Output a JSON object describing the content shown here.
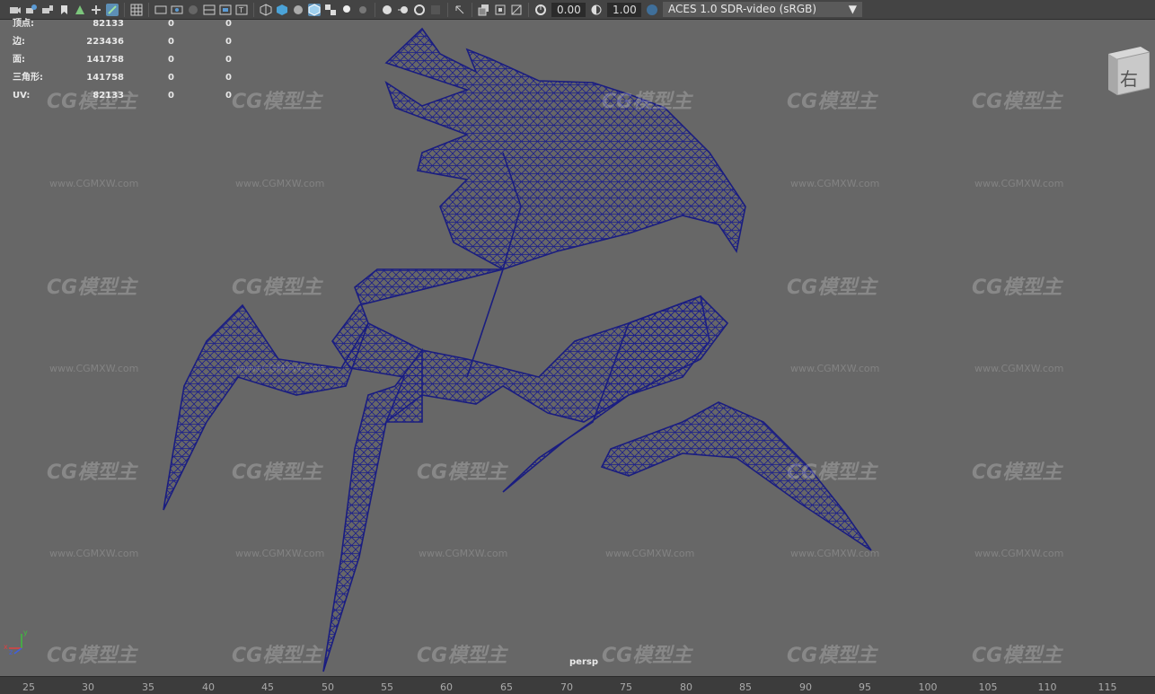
{
  "toolbar": {
    "icons": [
      "camera-icon",
      "camera-attr-icon",
      "bookmark-icon",
      "image-plane-icon",
      "2d-pan-icon",
      "grease-pencil-icon",
      "grid-icon",
      "film-gate-icon",
      "resolution-gate-icon",
      "gate-mask-icon",
      "field-chart-icon",
      "safe-action-icon",
      "safe-title-icon",
      "wireframe-icon",
      "smooth-shade-icon",
      "default-material-icon",
      "xray-icon",
      "textured-icon",
      "use-lights-icon",
      "shadows-icon",
      "ambient-occlusion-icon",
      "motion-blur-icon",
      "antialias-icon",
      "depth-of-field-icon",
      "isolate-select-icon",
      "xray-joints-icon",
      "xray-active-icon",
      "backface-icon",
      "exposure-icon",
      "gamma-icon",
      "color-manage-icon"
    ],
    "exposure_value": "0.00",
    "gamma_value": "1.00",
    "color_space": "ACES 1.0 SDR-video (sRGB)"
  },
  "hud": {
    "rows": [
      {
        "label": "顶点:",
        "v1": "82133",
        "v2": "0",
        "v3": "0"
      },
      {
        "label": "边:",
        "v1": "223436",
        "v2": "0",
        "v3": "0"
      },
      {
        "label": "面:",
        "v1": "141758",
        "v2": "0",
        "v3": "0"
      },
      {
        "label": "三角形:",
        "v1": "141758",
        "v2": "0",
        "v3": "0"
      },
      {
        "label": "UV:",
        "v1": "82133",
        "v2": "0",
        "v3": "0"
      }
    ]
  },
  "viewcube": {
    "face_label": "右"
  },
  "camera_label": "persp",
  "watermark": {
    "logo": "CG模型主",
    "url": "www.CGMXW.com"
  },
  "axis": {
    "x": "x",
    "y": "y",
    "z": "z"
  },
  "ruler": {
    "ticks": [
      "25",
      "30",
      "35",
      "40",
      "45",
      "50",
      "55",
      "60",
      "65",
      "70",
      "75",
      "80",
      "85",
      "90",
      "95",
      "100",
      "105",
      "110",
      "115"
    ]
  }
}
